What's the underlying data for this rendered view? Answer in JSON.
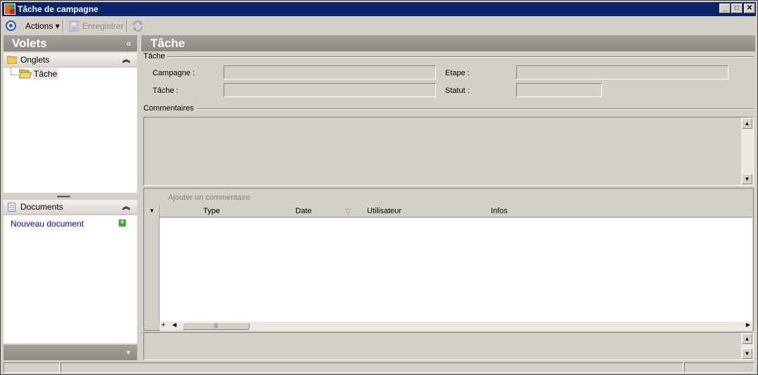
{
  "window": {
    "title": "Tâche de campagne"
  },
  "toolbar": {
    "actions_label": "Actions",
    "save_label": "Enregistrer"
  },
  "left": {
    "header": "Volets",
    "collapse_glyph": "«",
    "tabs_section": {
      "title": "Onglets",
      "items": [
        {
          "label": "Tâche"
        }
      ]
    },
    "docs_section": {
      "title": "Documents",
      "new_doc_label": "Nouveau document"
    }
  },
  "main": {
    "header": "Tâche",
    "task_group": {
      "title": "Tâche",
      "campaign_label": "Campagne :",
      "step_label": "Etape :",
      "task_label": "Tâche :",
      "status_label": "Statut :",
      "campaign_value": "",
      "step_value": "",
      "task_value": "",
      "status_value": ""
    },
    "comments_group": {
      "title": "Commentaires",
      "add_label": "Ajouter un commentaire",
      "columns": [
        "Type",
        "Date",
        "Utilisateur",
        "Infos"
      ]
    }
  },
  "colors": {
    "titlebar": "#0a246a",
    "panel_header": "#9a9791",
    "link": "#0000c0",
    "window_bg": "#d4d0c8"
  },
  "icons": {
    "app": "app-icon",
    "globe": "globe-icon",
    "save": "save-icon",
    "refresh": "refresh-icon",
    "folder": "folder-icon",
    "folder_open": "folder-open-icon",
    "document": "document-icon",
    "add": "add-icon"
  }
}
